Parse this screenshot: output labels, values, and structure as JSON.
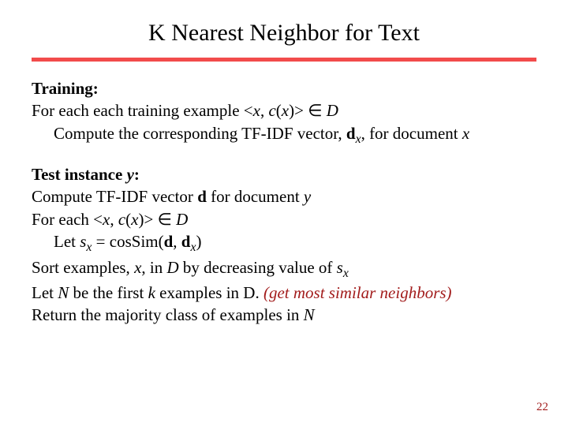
{
  "title": "K Nearest Neighbor for Text",
  "training": {
    "heading": "Training:",
    "line1_a": "For each each training example <",
    "line1_b": "x",
    "line1_c": ", ",
    "line1_d": "c",
    "line1_e": "(",
    "line1_f": "x",
    "line1_g": ")> ",
    "line1_h": "∈",
    "line1_i": "  D",
    "line2_a": "Compute the corresponding TF-IDF vector, ",
    "line2_b": "d",
    "line2_sub": "x",
    "line2_c": ", for document ",
    "line2_d": "x"
  },
  "test": {
    "heading_a": "Test instance ",
    "heading_b": "y",
    "heading_c": ":",
    "l1_a": "Compute TF-IDF vector ",
    "l1_b": "d",
    "l1_c": " for document ",
    "l1_d": "y",
    "l2_a": "For each <",
    "l2_b": "x",
    "l2_c": ", ",
    "l2_d": "c",
    "l2_e": "(",
    "l2_f": "x",
    "l2_g": ")> ",
    "l2_h": "∈",
    "l2_i": "  D",
    "l3_a": "Let ",
    "l3_b": "s",
    "l3_sub": "x",
    "l3_c": " = cosSim(",
    "l3_d": "d",
    "l3_e": ", ",
    "l3_f": "d",
    "l3_sub2": "x",
    "l3_g": ")",
    "l4_a": "Sort examples, ",
    "l4_b": "x",
    "l4_c": ", in ",
    "l4_d": "D",
    "l4_e": " by decreasing value of ",
    "l4_f": "s",
    "l4_sub": "x",
    "l5_a": "Let ",
    "l5_b": "N",
    "l5_c": " be the first ",
    "l5_d": "k",
    "l5_e": " examples in D.   ",
    "l5_note": "(get most similar neighbors)",
    "l6_a": "Return the majority class of examples in ",
    "l6_b": "N"
  },
  "pagenum": "22"
}
